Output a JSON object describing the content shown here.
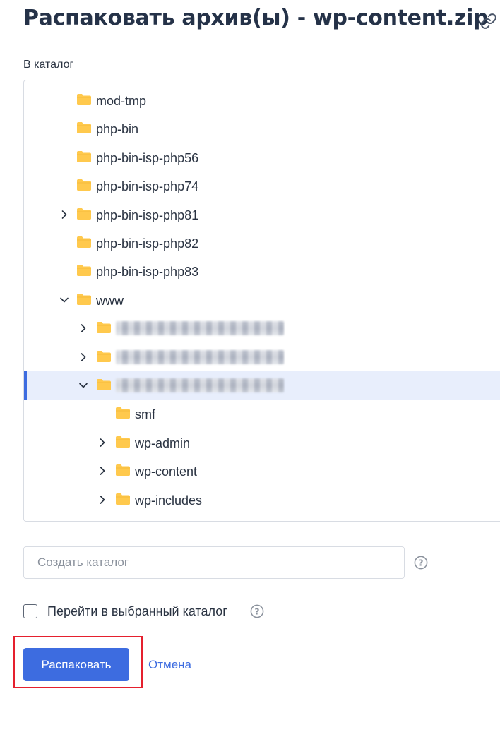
{
  "dialog": {
    "title": "Распаковать архив(ы) - wp-content.zip",
    "destination_label": "В каталог"
  },
  "tree": {
    "items": [
      {
        "name": "mod-tmp",
        "level": 1,
        "expander": "none",
        "selected": false,
        "redacted": false
      },
      {
        "name": "php-bin",
        "level": 1,
        "expander": "none",
        "selected": false,
        "redacted": false
      },
      {
        "name": "php-bin-isp-php56",
        "level": 1,
        "expander": "none",
        "selected": false,
        "redacted": false
      },
      {
        "name": "php-bin-isp-php74",
        "level": 1,
        "expander": "none",
        "selected": false,
        "redacted": false
      },
      {
        "name": "php-bin-isp-php81",
        "level": 1,
        "expander": "collapsed",
        "selected": false,
        "redacted": false
      },
      {
        "name": "php-bin-isp-php82",
        "level": 1,
        "expander": "none",
        "selected": false,
        "redacted": false
      },
      {
        "name": "php-bin-isp-php83",
        "level": 1,
        "expander": "none",
        "selected": false,
        "redacted": false
      },
      {
        "name": "www",
        "level": 1,
        "expander": "expanded",
        "selected": false,
        "redacted": false
      },
      {
        "name": "",
        "level": 2,
        "expander": "collapsed",
        "selected": false,
        "redacted": true
      },
      {
        "name": "",
        "level": 2,
        "expander": "collapsed",
        "selected": false,
        "redacted": true
      },
      {
        "name": "",
        "level": 2,
        "expander": "expanded",
        "selected": true,
        "redacted": true
      },
      {
        "name": "smf",
        "level": 3,
        "expander": "none",
        "selected": false,
        "redacted": false
      },
      {
        "name": "wp-admin",
        "level": 3,
        "expander": "collapsed",
        "selected": false,
        "redacted": false
      },
      {
        "name": "wp-content",
        "level": 3,
        "expander": "collapsed",
        "selected": false,
        "redacted": false
      },
      {
        "name": "wp-includes",
        "level": 3,
        "expander": "collapsed",
        "selected": false,
        "redacted": false
      }
    ]
  },
  "create_dir": {
    "placeholder": "Создать каталог",
    "value": ""
  },
  "goto_selected": {
    "label": "Перейти в выбранный каталог",
    "checked": false
  },
  "actions": {
    "submit_label": "Распаковать",
    "cancel_label": "Отмена"
  },
  "colors": {
    "accent": "#3d6ce0",
    "folder": "#ffc94d",
    "selected_row": "#e8eefc",
    "highlight_border": "#e5202e",
    "text": "#2a3342"
  },
  "icons": {
    "copy_link": "link-icon",
    "folder": "folder-icon",
    "expand": "chevron-right-icon",
    "collapse": "chevron-down-icon",
    "help": "question-circle-icon"
  }
}
